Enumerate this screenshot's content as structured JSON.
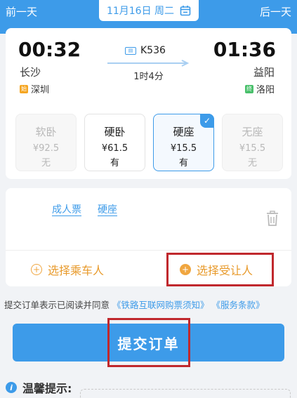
{
  "header": {
    "prev_day": "前一天",
    "date": "11月16日 周二",
    "next_day": "后一天"
  },
  "train": {
    "departure_time": "00:32",
    "arrival_time": "01:36",
    "from_station": "长沙",
    "to_station": "益阳",
    "train_no": "K536",
    "duration": "1时4分",
    "origin_badge": "始",
    "origin": "深圳",
    "terminal_badge": "终",
    "terminal": "洛阳"
  },
  "seats": [
    {
      "name": "软卧",
      "price": "¥92.5",
      "availability": "无",
      "state": "disabled"
    },
    {
      "name": "硬卧",
      "price": "¥61.5",
      "availability": "有",
      "state": "normal"
    },
    {
      "name": "硬座",
      "price": "¥15.5",
      "availability": "有",
      "state": "selected"
    },
    {
      "name": "无座",
      "price": "¥15.5",
      "availability": "无",
      "state": "disabled"
    }
  ],
  "passenger": {
    "ticket_type": "成人票",
    "seat_type": "硬座",
    "add_passenger": "选择乘车人",
    "select_yield": "选择受让人"
  },
  "agreement": {
    "prefix": "提交订单表示已阅读并同意",
    "link1": "《铁路互联网购票须知》",
    "link2": "《服务条款》"
  },
  "submit_label": "提交订单",
  "tips_label": "温馨提示:",
  "colors": {
    "primary": "#3d9be9",
    "accent": "#f0a640",
    "highlight": "#c0282d"
  }
}
